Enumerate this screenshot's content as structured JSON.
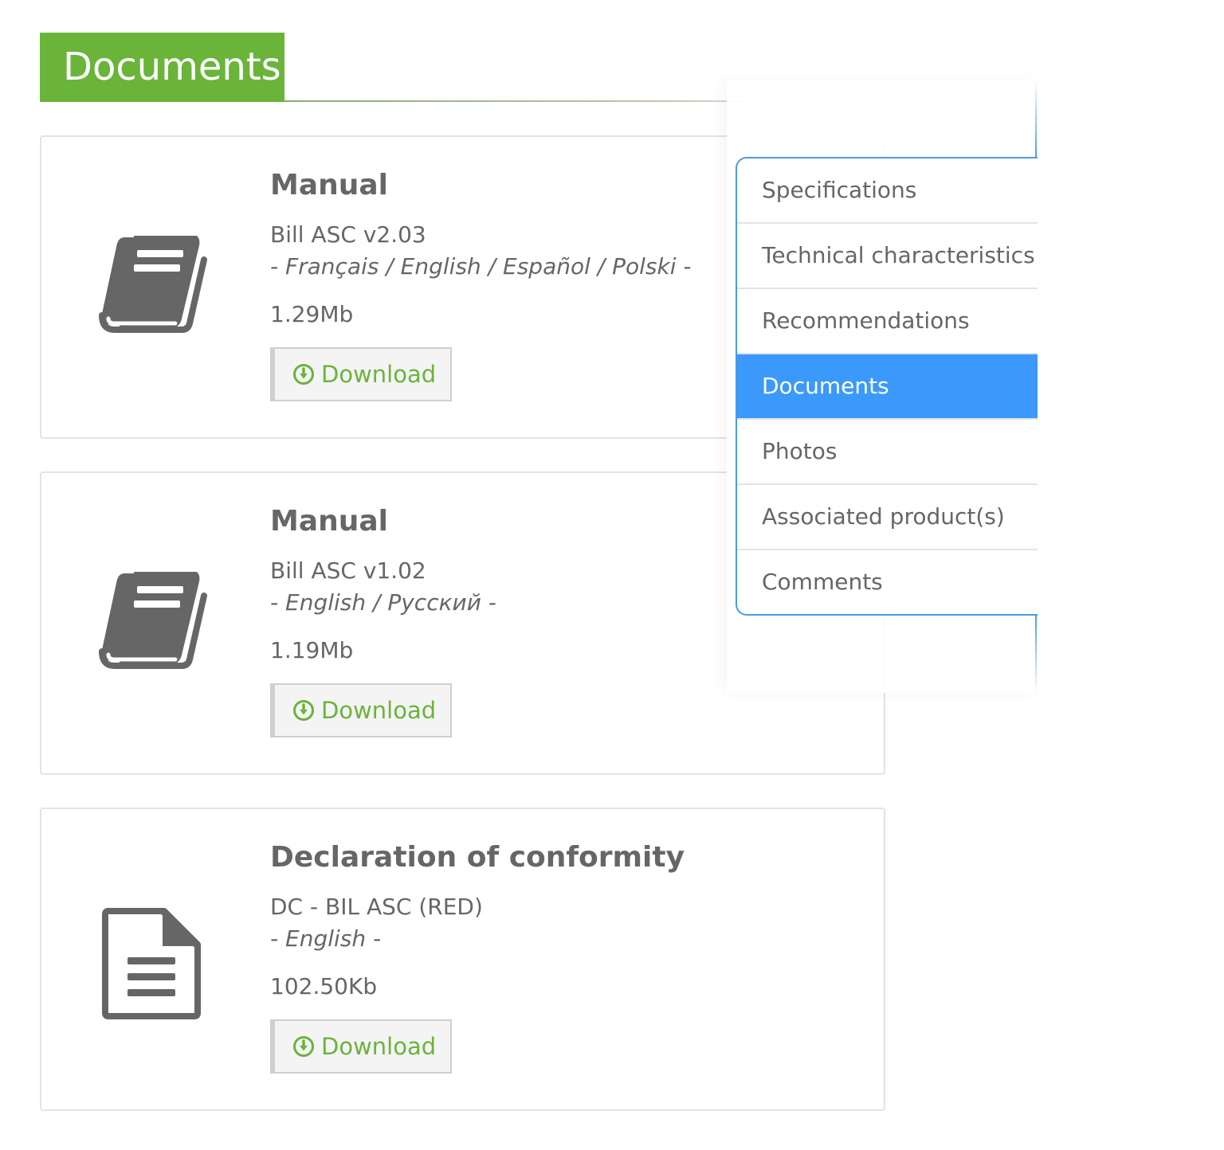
{
  "section": {
    "title": "Documents"
  },
  "documents": [
    {
      "icon": "book-icon",
      "title": "Manual",
      "name": "Bill ASC v2.03",
      "languages": "- Français / English / Español / Polski -",
      "size": "1.29Mb",
      "download_label": "Download"
    },
    {
      "icon": "book-icon",
      "title": "Manual",
      "name": "Bill ASC v1.02",
      "languages": "- English / Русский -",
      "size": "1.19Mb",
      "download_label": "Download"
    },
    {
      "icon": "file-text-icon",
      "title": "Declaration of conformity",
      "name": "DC - BIL ASC (RED)",
      "languages": "- English -",
      "size": "102.50Kb",
      "download_label": "Download"
    }
  ],
  "tabs_menu": {
    "items": [
      {
        "label": "Specifications",
        "active": false
      },
      {
        "label": "Technical characteristics",
        "active": false
      },
      {
        "label": "Recommendations",
        "active": false
      },
      {
        "label": "Documents",
        "active": true
      },
      {
        "label": "Photos",
        "active": false
      },
      {
        "label": "Associated product(s)",
        "active": false
      },
      {
        "label": "Comments",
        "active": false
      }
    ]
  },
  "colors": {
    "brand_green": "#6ab43a",
    "active_blue": "#3b99fc",
    "menu_border_blue": "#4a9ce0",
    "text_gray": "#666666"
  }
}
